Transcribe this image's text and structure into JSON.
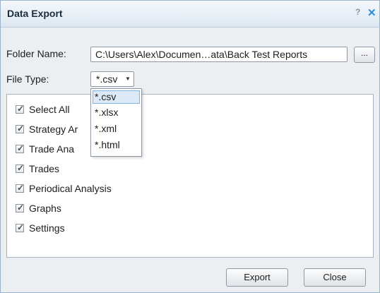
{
  "dialog": {
    "title": "Data Export",
    "help_glyph": "?",
    "close_glyph": "✕"
  },
  "folder": {
    "label": "Folder Name:",
    "value": "C:\\Users\\Alex\\Documen…ata\\Back Test Reports",
    "browse_label": "..."
  },
  "file_type": {
    "label": "File Type:",
    "selected": "*.csv",
    "options": [
      "*.csv",
      "*.xlsx",
      "*.xml",
      "*.html"
    ]
  },
  "sections": [
    {
      "label": "Select All",
      "checked": true
    },
    {
      "label": "Strategy Ar",
      "checked": true
    },
    {
      "label": "Trade Ana",
      "checked": true
    },
    {
      "label": "Trades",
      "checked": true
    },
    {
      "label": "Periodical Analysis",
      "checked": true
    },
    {
      "label": "Graphs",
      "checked": true
    },
    {
      "label": "Settings",
      "checked": true
    }
  ],
  "buttons": {
    "export": "Export",
    "close": "Close"
  },
  "colors": {
    "title_bar": "#dde7f1",
    "accent": "#2d8ed8",
    "selected_option": "#dceaf8"
  }
}
